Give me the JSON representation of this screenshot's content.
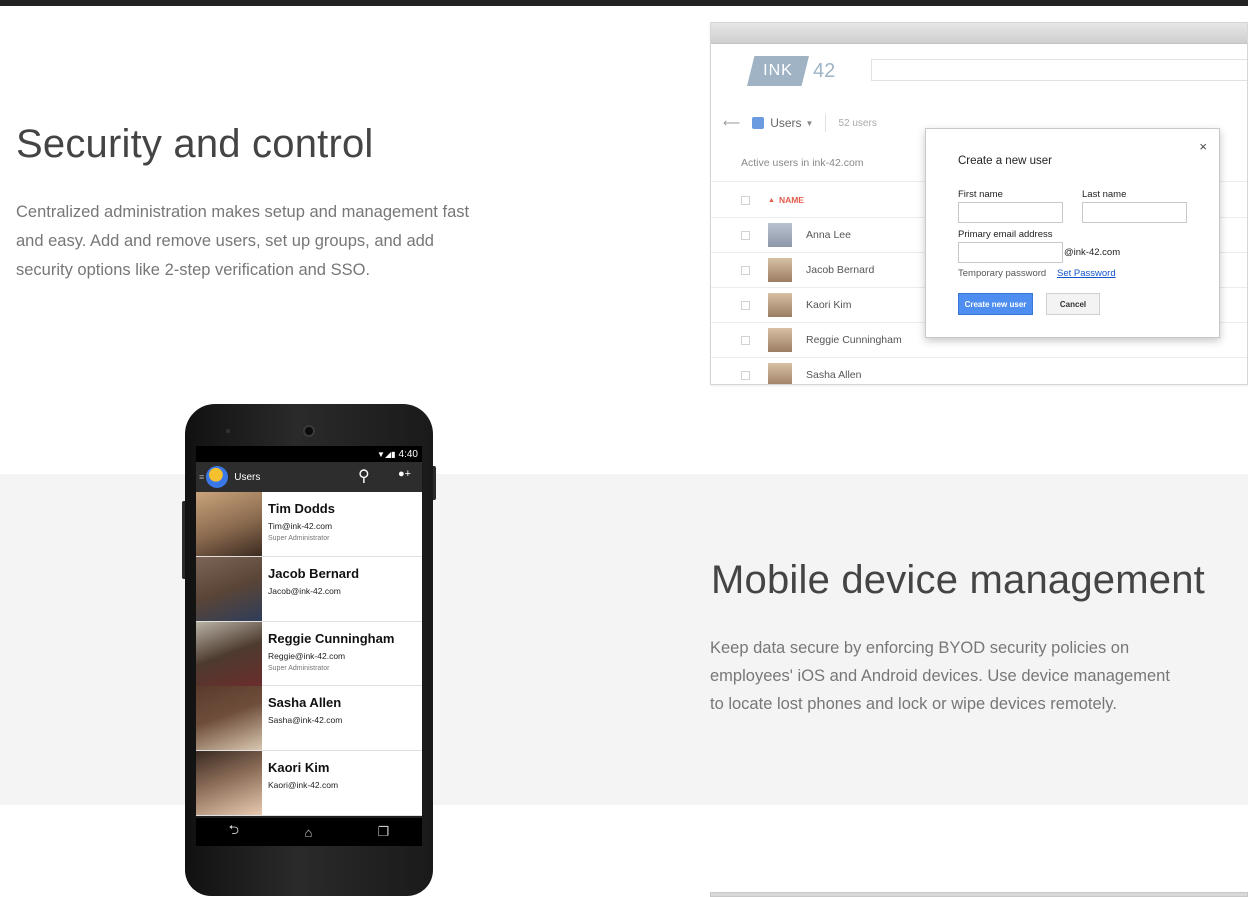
{
  "sections": {
    "security": {
      "title": "Security and control",
      "lines": [
        "Centralized administration makes setup and management fast",
        "and easy. Add and remove users, set up groups, and add",
        "security options like 2-step verification and SSO."
      ]
    },
    "mobile": {
      "title": "Mobile device management",
      "lines": [
        "Keep data secure by enforcing BYOD security policies on",
        "employees' iOS and Android devices. Use device management",
        "to locate lost phones and lock or wipe devices remotely."
      ]
    }
  },
  "console": {
    "logo_text": "INK",
    "logo_number": "42",
    "breadcrumb": {
      "label": "Users",
      "count": "52 users"
    },
    "active_label": "Active users in ink-42.com",
    "column_name": "NAME",
    "users": [
      "Anna Lee",
      "Jacob Bernard",
      "Kaori Kim",
      "Reggie Cunningham",
      "Sasha Allen"
    ],
    "dialog": {
      "title": "Create a new user",
      "first_name_label": "First name",
      "last_name_label": "Last name",
      "email_label": "Primary email address",
      "email_suffix": "@ink-42.com",
      "temp_password_label": "Temporary password",
      "set_password_link": "Set Password",
      "create_button": "Create new user",
      "cancel_button": "Cancel"
    }
  },
  "phone": {
    "status_time": "4:40",
    "app_title": "Users",
    "contacts": [
      {
        "name": "Tim Dodds",
        "email": "Tim@ink-42.com",
        "role": "Super Administrator",
        "photo_color": "#8a6a4f"
      },
      {
        "name": "Jacob Bernard",
        "email": "Jacob@ink-42.com",
        "role": "",
        "photo_color": "#5a4536"
      },
      {
        "name": "Reggie Cunningham",
        "email": "Reggie@ink-42.com",
        "role": "Super Administrator",
        "photo_color": "#4d3a2f"
      },
      {
        "name": "Sasha Allen",
        "email": "Sasha@ink-42.com",
        "role": "",
        "photo_color": "#6e4e3b"
      },
      {
        "name": "Kaori Kim",
        "email": "Kaori@ink-42.com",
        "role": "",
        "photo_color": "#8c6d58"
      }
    ]
  },
  "colors": {
    "accent_blue": "#4d8ef0",
    "link_blue": "#1155cc",
    "sort_red": "#e45b4a",
    "band_gray": "#f4f4f4"
  }
}
